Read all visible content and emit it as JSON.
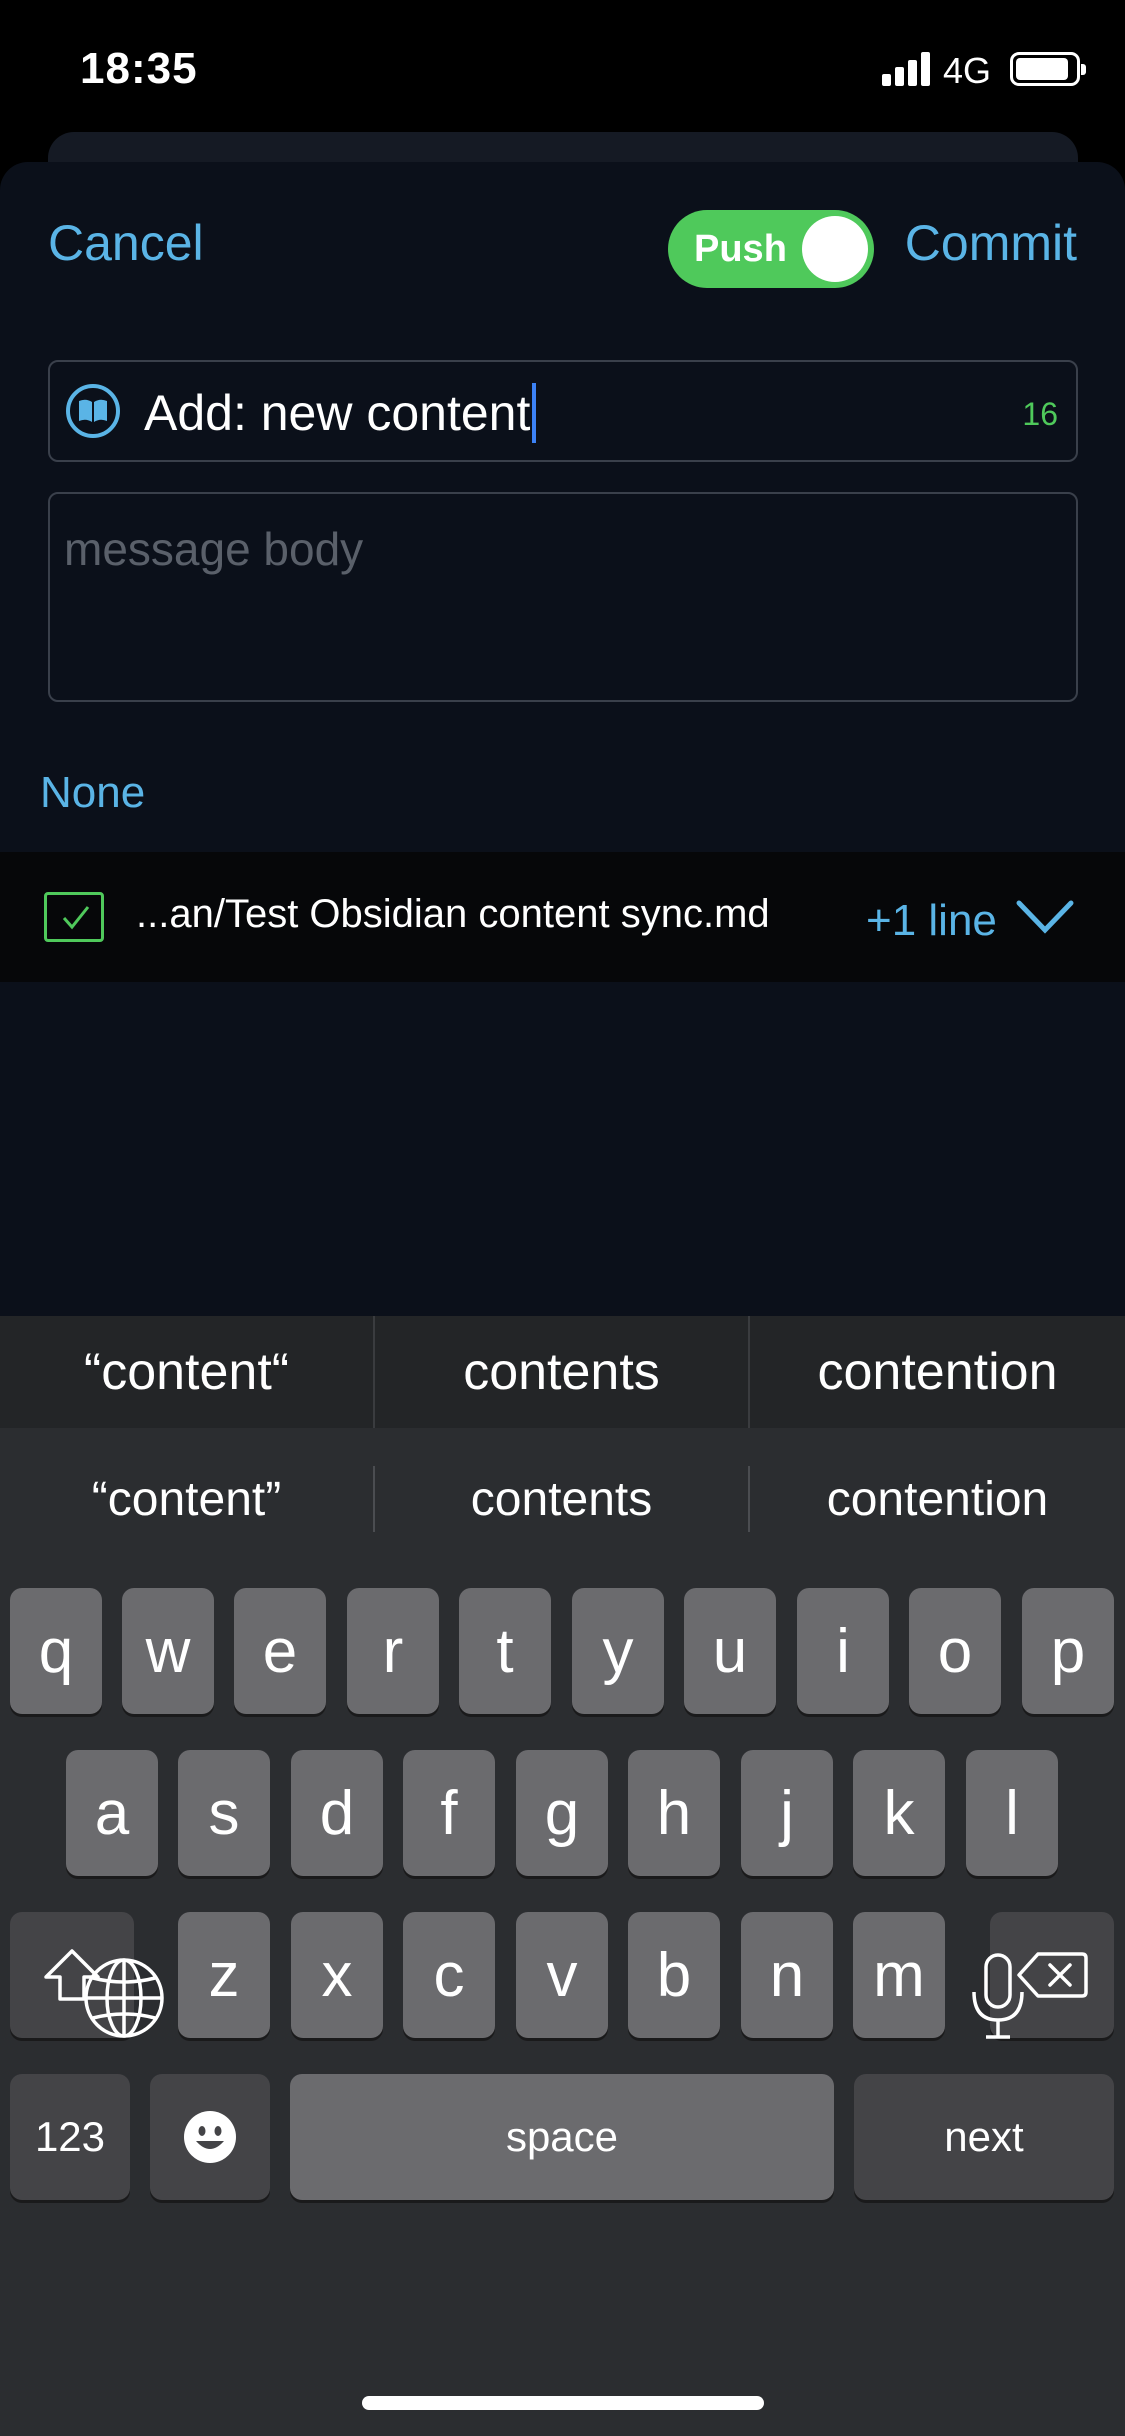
{
  "status_bar": {
    "time": "18:35",
    "network": "4G"
  },
  "header": {
    "cancel_label": "Cancel",
    "commit_label": "Commit",
    "push_label": "Push",
    "push_enabled": true
  },
  "commit_form": {
    "title_value": "Add: new content",
    "char_count": "16",
    "body_placeholder": "message body"
  },
  "files": {
    "selection_label": "None",
    "items": [
      {
        "path": "...an/Test Obsidian content sync.md",
        "changes": "+1 line",
        "checked": true
      }
    ]
  },
  "keyboard": {
    "suggestions_top": [
      "“content“",
      "contents",
      "contention"
    ],
    "suggestions": [
      "“content”",
      "contents",
      "contention"
    ],
    "row1": [
      "q",
      "w",
      "e",
      "r",
      "t",
      "y",
      "u",
      "i",
      "o",
      "p"
    ],
    "row2": [
      "a",
      "s",
      "d",
      "f",
      "g",
      "h",
      "j",
      "k",
      "l"
    ],
    "row3": [
      "z",
      "x",
      "c",
      "v",
      "b",
      "n",
      "m"
    ],
    "numbers_label": "123",
    "space_label": "space",
    "return_label": "next"
  },
  "colors": {
    "accent": "#5ab4e6",
    "green": "#4fc95b",
    "background": "#0b101a"
  }
}
